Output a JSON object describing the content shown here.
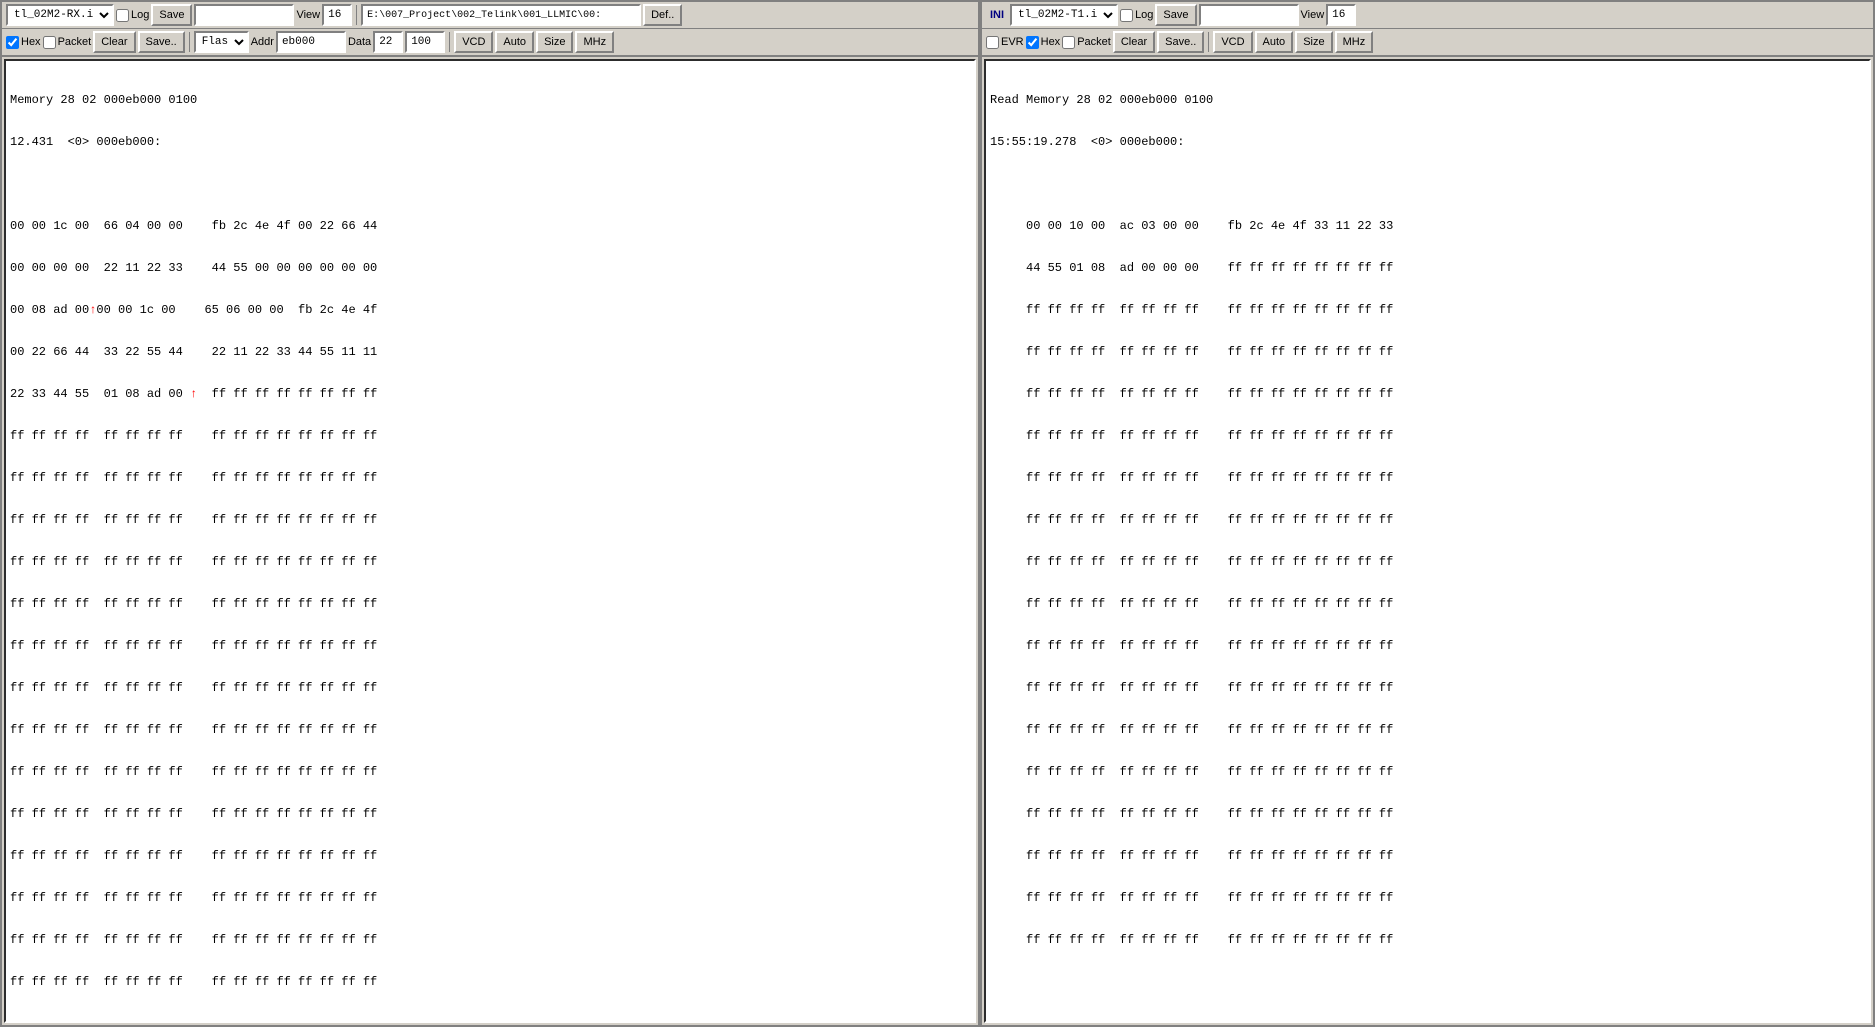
{
  "left_panel": {
    "toolbar1": {
      "device_select_label": "tl_02M2-RX.i",
      "log_checkbox_label": "Log",
      "log_checked": false,
      "save_button": "Save",
      "view_label": "View",
      "view_value": "16",
      "path_value": "E:\\007_Project\\002_Telink\\001_LLMIC\\00:",
      "def_button": "Def..",
      "flash_select": "Flash",
      "addr_label": "Addr",
      "addr_value": "eb000",
      "data_label": "Data",
      "data_value": "22",
      "num_value": "100"
    },
    "toolbar2": {
      "hex_checkbox_label": "Hex",
      "hex_checked": true,
      "packet_checkbox_label": "Packet",
      "packet_checked": false,
      "clear_button": "Clear",
      "save_dot_button": "Save..",
      "vcd_button": "VCD",
      "auto_button": "Auto",
      "size_button": "Size",
      "mhz_button": "MHz"
    },
    "console": {
      "line1": "Memory 28 02 000eb000 0100",
      "line2": "12.431  <0> 000eb000:",
      "data_rows": [
        "00 00 1c 00  66 04 00 00    fb 2c 4e 4f 00 22 66 44",
        "00 00 00 00  22 11 22 33    44 55 00 00 00 00 00 00",
        "00 08 ad 00↑ 00 00 1c 00    65 06 00 00  fb 2c 4e 4f",
        "00 22 66 44  33 22 55 44    22 11 22 33 44 55 11 11",
        "22 33 44 55  01 08 ad 00 ↑  ff ff ff ff ff ff ff ff",
        "ff ff ff ff  ff ff ff ff    ff ff ff ff ff ff ff ff",
        "ff ff ff ff  ff ff ff ff    ff ff ff ff ff ff ff ff",
        "ff ff ff ff  ff ff ff ff    ff ff ff ff ff ff ff ff",
        "ff ff ff ff  ff ff ff ff    ff ff ff ff ff ff ff ff",
        "ff ff ff ff  ff ff ff ff    ff ff ff ff ff ff ff ff",
        "ff ff ff ff  ff ff ff ff    ff ff ff ff ff ff ff ff",
        "ff ff ff ff  ff ff ff ff    ff ff ff ff ff ff ff ff",
        "ff ff ff ff  ff ff ff ff    ff ff ff ff ff ff ff ff",
        "ff ff ff ff  ff ff ff ff    ff ff ff ff ff ff ff ff",
        "ff ff ff ff  ff ff ff ff    ff ff ff ff ff ff ff ff",
        "ff ff ff ff  ff ff ff ff    ff ff ff ff ff ff ff ff",
        "ff ff ff ff  ff ff ff ff    ff ff ff ff ff ff ff ff",
        "ff ff ff ff  ff ff ff ff    ff ff ff ff ff ff ff ff",
        "ff ff ff ff  ff ff ff ff    ff ff ff ff ff ff ff ff"
      ]
    }
  },
  "right_panel": {
    "toolbar1": {
      "ini_label": "INI",
      "device_select_label": "tl_02M2-T1.i",
      "log_checkbox_label": "Log",
      "log_checked": false,
      "save_button": "Save",
      "view_label": "View",
      "view_value": "16"
    },
    "toolbar2": {
      "evr_checkbox_label": "EVR",
      "evr_checked": false,
      "hex_checkbox_label": "Hex",
      "hex_checked": true,
      "packet_checkbox_label": "Packet",
      "packet_checked": false,
      "clear_button": "Clear",
      "save_dot_button": "Save..",
      "vcd_button": "VCD",
      "auto_button": "Auto",
      "size_button": "Size",
      "mhz_button": "MHz"
    },
    "console": {
      "line1": "Read Memory 28 02 000eb000 0100",
      "line2": "15:55:19.278  <0> 000eb000:",
      "data_rows": [
        "     00 00 10 00  ac 03 00 00    fb 2c 4e 4f 33 11 22 33",
        "     44 55 01 08  ad 00 00 00    ff ff ff ff ff ff ff ff",
        "     ff ff ff ff  ff ff ff ff    ff ff ff ff ff ff ff ff",
        "     ff ff ff ff  ff ff ff ff    ff ff ff ff ff ff ff ff",
        "     ff ff ff ff  ff ff ff ff    ff ff ff ff ff ff ff ff",
        "     ff ff ff ff  ff ff ff ff    ff ff ff ff ff ff ff ff",
        "     ff ff ff ff  ff ff ff ff    ff ff ff ff ff ff ff ff",
        "     ff ff ff ff  ff ff ff ff    ff ff ff ff ff ff ff ff",
        "     ff ff ff ff  ff ff ff ff    ff ff ff ff ff ff ff ff",
        "     ff ff ff ff  ff ff ff ff    ff ff ff ff ff ff ff ff",
        "     ff ff ff ff  ff ff ff ff    ff ff ff ff ff ff ff ff",
        "     ff ff ff ff  ff ff ff ff    ff ff ff ff ff ff ff ff",
        "     ff ff ff ff  ff ff ff ff    ff ff ff ff ff ff ff ff",
        "     ff ff ff ff  ff ff ff ff    ff ff ff ff ff ff ff ff",
        "     ff ff ff ff  ff ff ff ff    ff ff ff ff ff ff ff ff",
        "     ff ff ff ff  ff ff ff ff    ff ff ff ff ff ff ff ff",
        "     ff ff ff ff  ff ff ff ff    ff ff ff ff ff ff ff ff",
        "     ff ff ff ff  ff ff ff ff    ff ff ff ff ff ff ff ff"
      ]
    }
  }
}
